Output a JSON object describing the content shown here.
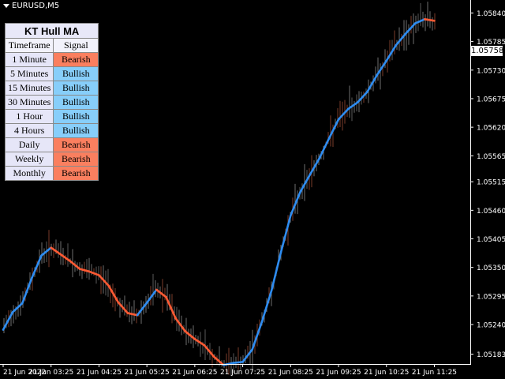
{
  "symbol": "EURUSD,M5",
  "colors": {
    "background": "#000000",
    "bullish_line": "#2e8cf0",
    "bearish_line": "#ff5a33",
    "bull_cell": "#87cefa",
    "bear_cell": "#fa7f5f"
  },
  "panel": {
    "title": "KT Hull MA",
    "headers": [
      "Timeframe",
      "Signal"
    ],
    "rows": [
      {
        "timeframe": "1 Minute",
        "signal": "Bearish"
      },
      {
        "timeframe": "5 Minutes",
        "signal": "Bullish"
      },
      {
        "timeframe": "15 Minutes",
        "signal": "Bullish"
      },
      {
        "timeframe": "30 Minutes",
        "signal": "Bullish"
      },
      {
        "timeframe": "1 Hour",
        "signal": "Bullish"
      },
      {
        "timeframe": "4 Hours",
        "signal": "Bullish"
      },
      {
        "timeframe": "Daily",
        "signal": "Bearish"
      },
      {
        "timeframe": "Weekly",
        "signal": "Bearish"
      },
      {
        "timeframe": "Monthly",
        "signal": "Bearish"
      }
    ]
  },
  "current_price": "1.05758",
  "chart_data": {
    "type": "line",
    "title": "",
    "xlabel": "",
    "ylabel": "",
    "x_ticks": [
      "21 Jun 2022",
      "21 Jun 03:25",
      "21 Jun 04:25",
      "21 Jun 05:25",
      "21 Jun 06:25",
      "21 Jun 07:25",
      "21 Jun 08:25",
      "21 Jun 09:25",
      "21 Jun 10:25",
      "21 Jun 11:25"
    ],
    "y_ticks": [
      1.05183,
      1.0524,
      1.05295,
      1.0535,
      1.05405,
      1.0546,
      1.05515,
      1.05565,
      1.0562,
      1.05675,
      1.0573,
      1.05785,
      1.0584
    ],
    "ylim": [
      1.05164,
      1.05865
    ],
    "grid": false,
    "series": [
      {
        "x": [
          0,
          0.2,
          0.4,
          0.6,
          0.8,
          1.0,
          1.2,
          1.4,
          1.6,
          1.8,
          2.0,
          2.2,
          2.4,
          2.6,
          2.8,
          3.0,
          3.2,
          3.4,
          3.6,
          3.8,
          4.0,
          4.2,
          4.4,
          4.6,
          4.8,
          5.0,
          5.2,
          5.4,
          5.6,
          5.8,
          6.0,
          6.2,
          6.4,
          6.6,
          6.8,
          7.0,
          7.2,
          7.4,
          7.6,
          7.8,
          8.0,
          8.2,
          8.4,
          8.6,
          8.8,
          9.0
        ],
        "values": [
          1.0523,
          1.05264,
          1.05281,
          1.0533,
          1.05373,
          1.05388,
          1.05375,
          1.05362,
          1.05347,
          1.05342,
          1.05335,
          1.05315,
          1.05283,
          1.05262,
          1.05258,
          1.05282,
          1.05307,
          1.05293,
          1.05252,
          1.05227,
          1.05212,
          1.052,
          1.05178,
          1.05162,
          1.05166,
          1.05168,
          1.05192,
          1.05245,
          1.05305,
          1.0538,
          1.0545,
          1.05495,
          1.05528,
          1.0556,
          1.05598,
          1.05635,
          1.05655,
          1.05668,
          1.05688,
          1.0572,
          1.05748,
          1.05778,
          1.058,
          1.0582,
          1.05828,
          1.05825
        ]
      }
    ]
  }
}
